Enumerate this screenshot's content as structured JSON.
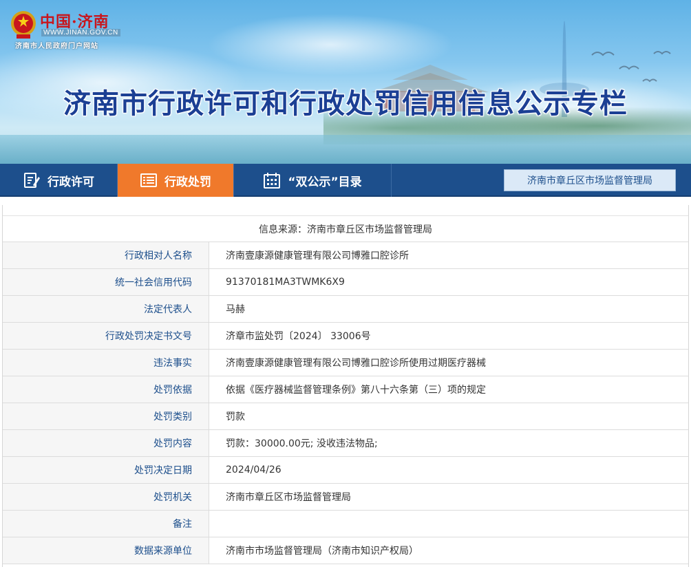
{
  "logo": {
    "name_cn": "中国·济南",
    "url": "WWW.JINAN.GOV.CN",
    "subtitle": "济南市人民政府门户网站"
  },
  "banner": {
    "title": "济南市行政许可和行政处罚信用信息公示专栏"
  },
  "nav": {
    "items": [
      {
        "label": "行政许可",
        "icon": "edit-document-icon",
        "active": false
      },
      {
        "label": "行政处罚",
        "icon": "list-icon",
        "active": true
      },
      {
        "label": "“双公示”目录",
        "icon": "calendar-icon",
        "active": false
      }
    ],
    "org_label": "济南市章丘区市场监督管理局"
  },
  "record": {
    "source": "信息来源：济南市章丘区市场监督管理局",
    "fields": [
      {
        "label": "行政相对人名称",
        "value": "济南壹康源健康管理有限公司博雅口腔诊所"
      },
      {
        "label": "统一社会信用代码",
        "value": "91370181MA3TWMK6X9"
      },
      {
        "label": "法定代表人",
        "value": "马赫"
      },
      {
        "label": "行政处罚决定书文号",
        "value": "济章市监处罚〔2024〕 33006号"
      },
      {
        "label": "违法事实",
        "value": "济南壹康源健康管理有限公司博雅口腔诊所使用过期医疗器械"
      },
      {
        "label": "处罚依据",
        "value": "依据《医疗器械监督管理条例》第八十六条第（三）项的规定"
      },
      {
        "label": "处罚类别",
        "value": "罚款"
      },
      {
        "label": "处罚内容",
        "value": "罚款：30000.00元; 没收违法物品;"
      },
      {
        "label": "处罚决定日期",
        "value": "2024/04/26"
      },
      {
        "label": "处罚机关",
        "value": "济南市章丘区市场监督管理局"
      },
      {
        "label": "备注",
        "value": ""
      },
      {
        "label": "数据来源单位",
        "value": "济南市市场监督管理局（济南市知识产权局）"
      }
    ]
  },
  "colors": {
    "nav_bg": "#1d4f8c",
    "nav_active": "#f0792b",
    "title_blue": "#1b3f94",
    "label_blue": "#1d4f8c"
  }
}
